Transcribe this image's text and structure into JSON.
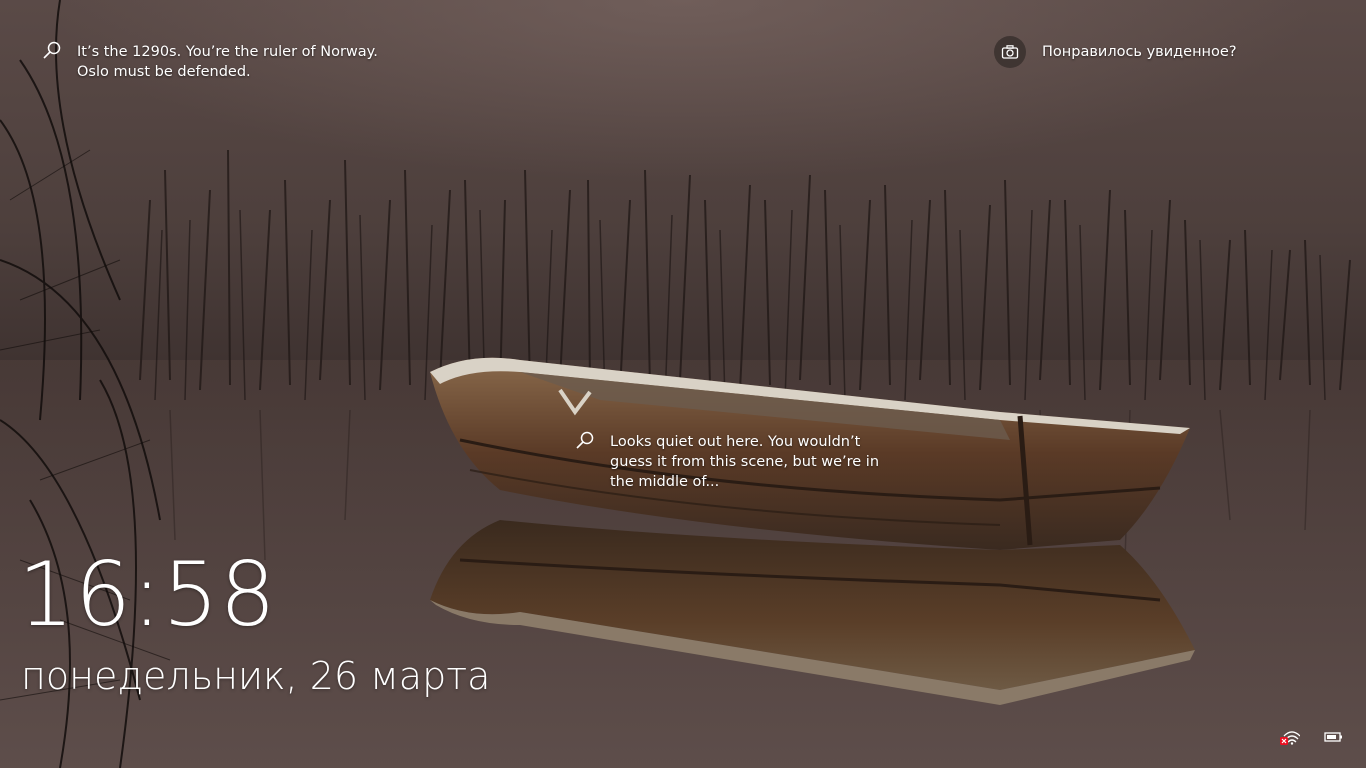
{
  "spotlight": {
    "top_tip": "It’s the 1290s. You’re the ruler of Norway. Oslo must be defended.",
    "middle_tip": "Looks quiet out here. You wouldn’t guess it from this scene, but we’re in the middle of..."
  },
  "like_prompt": {
    "label": "Понравилось увиденное?",
    "icon": "camera-icon"
  },
  "clock": {
    "time": "16:58",
    "date": "понедельник, 26 марта"
  },
  "status": {
    "network_icon": "network-disconnected-icon",
    "battery_icon": "battery-icon"
  }
}
